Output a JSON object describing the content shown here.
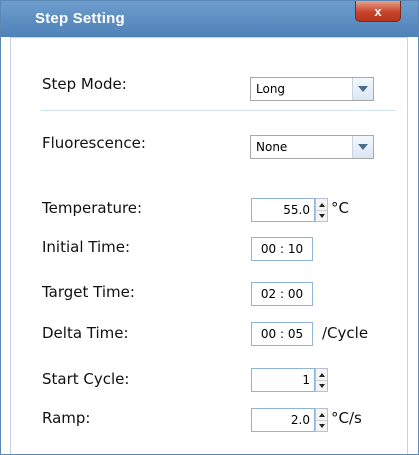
{
  "window": {
    "title": "Step Setting",
    "close_glyph": "x"
  },
  "form": {
    "step_mode": {
      "label": "Step Mode:",
      "value": "Long"
    },
    "fluorescence": {
      "label": "Fluorescence:",
      "value": "None"
    },
    "temperature": {
      "label": "Temperature:",
      "value": "55.0",
      "unit": "°C"
    },
    "initial_time": {
      "label": "Initial Time:",
      "value": "00 : 10"
    },
    "target_time": {
      "label": "Target Time:",
      "value": "02 : 00"
    },
    "delta_time": {
      "label": "Delta Time:",
      "value": "00 : 05",
      "unit": "/Cycle"
    },
    "start_cycle": {
      "label": "Start Cycle:",
      "value": "1"
    },
    "ramp": {
      "label": "Ramp:",
      "value": "2.0",
      "unit": "°C/s"
    }
  }
}
